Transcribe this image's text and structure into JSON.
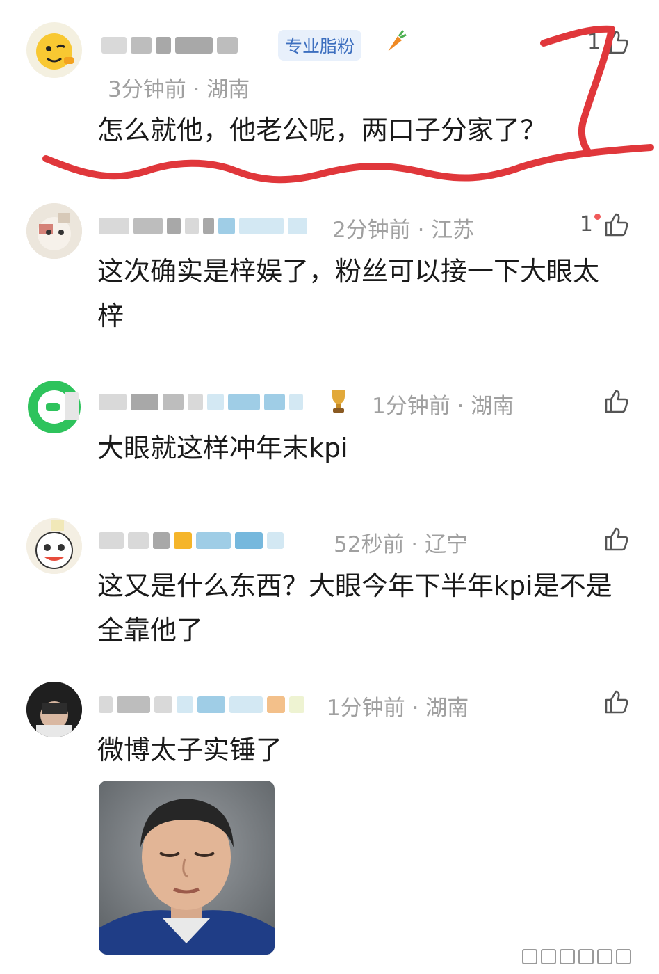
{
  "comments": [
    {
      "badge": "专业脂粉",
      "meta": "3分钟前 · 湖南",
      "likes": "1",
      "text": "怎么就他，他老公呢，两口子分家了？"
    },
    {
      "meta": "2分钟前 · 江苏",
      "likes": "1",
      "text": "这次确实是梓娱了，粉丝可以接一下大眼太梓"
    },
    {
      "meta": "1分钟前 · 湖南",
      "likes": "",
      "text": "大眼就这样冲年末kpi"
    },
    {
      "meta": "52秒前 · 辽宁",
      "likes": "",
      "text": "这又是什么东西？大眼今年下半年kpi是不是全靠他了"
    },
    {
      "meta": "1分钟前 · 湖南",
      "likes": "",
      "text": "微博太子实锤了"
    }
  ],
  "colors": {
    "annotation_red": "#e0373b",
    "meta_gray": "#a0a0a0",
    "badge_blue": "#3d6fbf"
  },
  "icons": [
    "thumbs-up-icon",
    "carrot-icon",
    "trophy-icon"
  ]
}
